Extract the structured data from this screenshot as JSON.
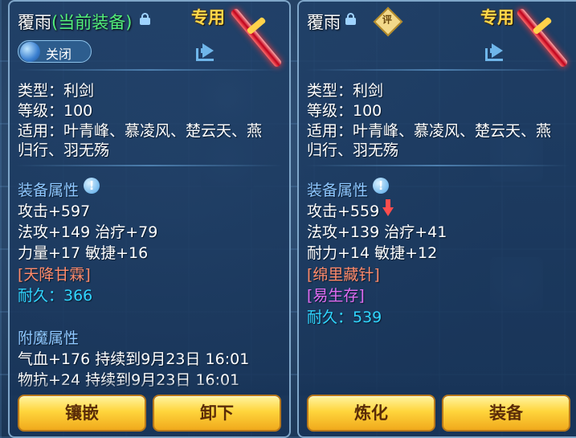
{
  "left": {
    "name": "覆雨",
    "equipped_tag": "(当前装备)",
    "exclusive": "专用",
    "toggle_label": "关闭",
    "lines": {
      "type": "类型：利剑",
      "level": "等级：100",
      "applicable_1": "适用：叶青峰、慕凌风、楚云天、燕",
      "applicable_2": "归行、羽无殇",
      "attr_header": "装备属性",
      "attack": "攻击+597",
      "magic_heal": "法攻+149 治疗+79",
      "str_agi": "力量+17 敏捷+16",
      "skill": "[天降甘霖]",
      "durability": "耐久：366",
      "enchant_header": "附魔属性",
      "enchant_1": "气血+176 持续到9月23日 16:01",
      "enchant_2": "物抗+24 持续到9月23日 16:01"
    },
    "buttons": {
      "inlay": "镶嵌",
      "unequip": "卸下"
    }
  },
  "right": {
    "name": "覆雨",
    "rate_badge": "评",
    "exclusive": "专用",
    "lines": {
      "type": "类型：利剑",
      "level": "等级：100",
      "applicable_1": "适用：叶青峰、慕凌风、楚云天、燕",
      "applicable_2": "归行、羽无殇",
      "attr_header": "装备属性",
      "attack": "攻击+559",
      "magic_heal": "法攻+139 治疗+41",
      "end_agi": "耐力+14 敏捷+12",
      "skill_1": "[绵里藏针]",
      "skill_2": "[易生存]",
      "durability": "耐久：539"
    },
    "buttons": {
      "refine": "炼化",
      "equip": "装备"
    }
  },
  "colors": {
    "accent_gold": "#ffd84a",
    "equipped_green": "#52ef7a",
    "header_blue": "#8ec7ff",
    "skill_orange": "#ff8a6a",
    "skill_pink": "#e06cf2",
    "durability_cyan": "#30d6ff",
    "decrease_red": "#ff4d4d"
  },
  "icons": [
    "lock-icon",
    "share-icon",
    "info-icon",
    "down-arrow-icon",
    "weapon-icon",
    "rate-badge-icon"
  ]
}
